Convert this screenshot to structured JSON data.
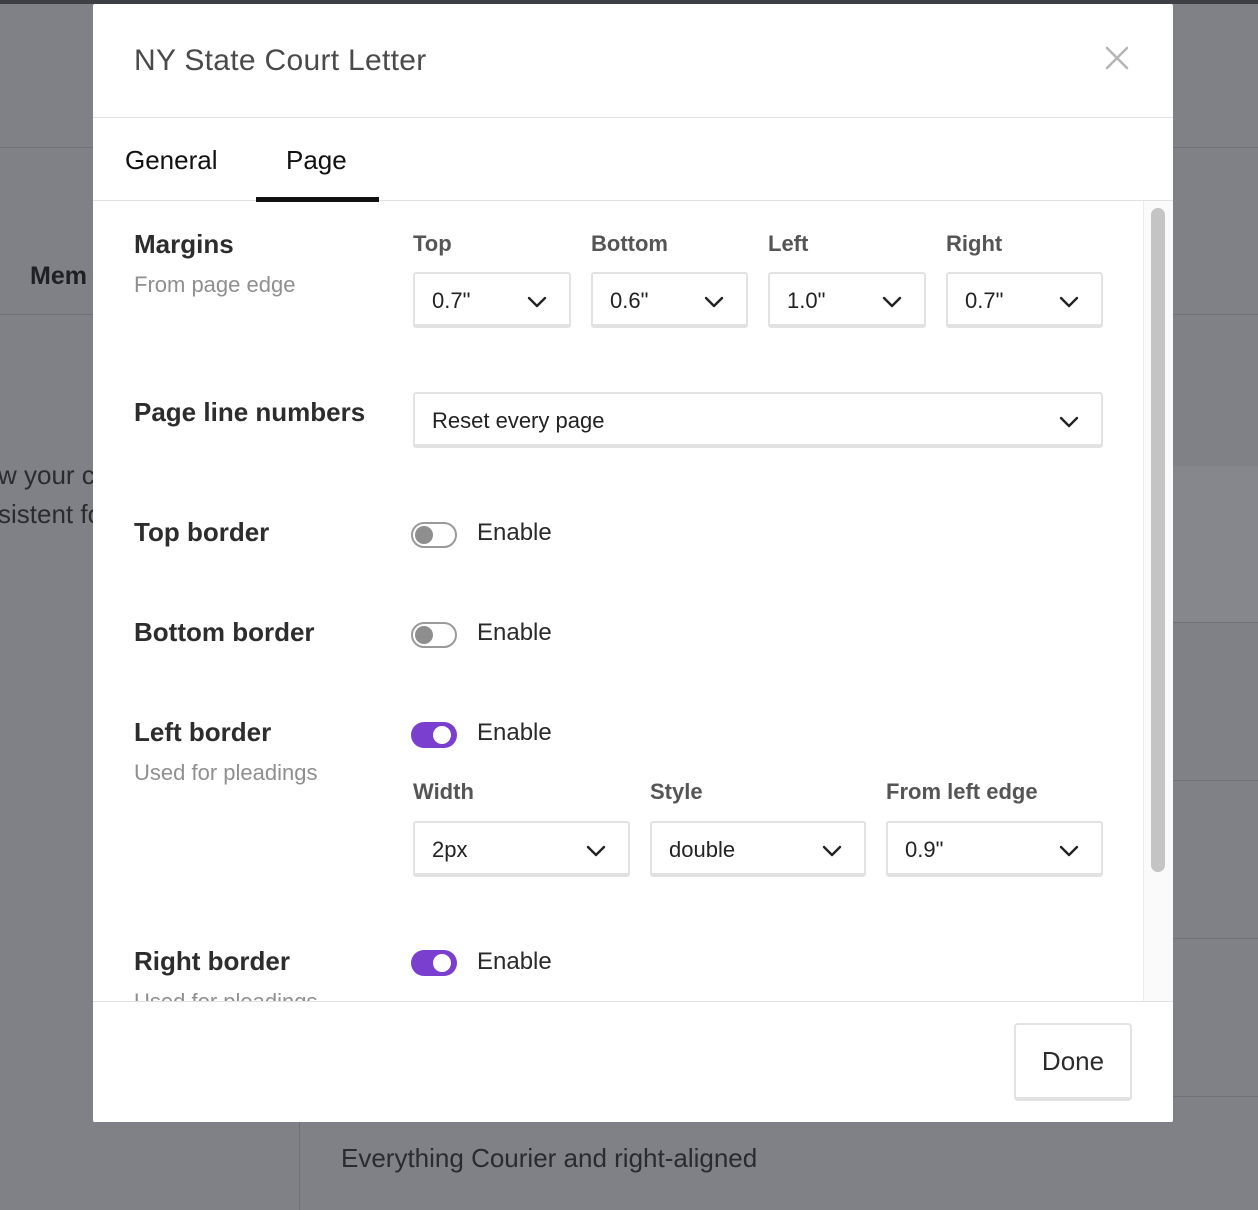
{
  "background": {
    "nav_fragment": "Mem",
    "text_line1": "w your c",
    "text_line2": "sistent fo",
    "bottom_text": "Everything Courier and right-aligned"
  },
  "modal": {
    "title": "NY State Court Letter",
    "close_icon": "close-icon",
    "tabs": [
      {
        "label": "General",
        "active": false
      },
      {
        "label": "Page",
        "active": true
      }
    ],
    "margins": {
      "label": "Margins",
      "sublabel": "From page edge",
      "top": {
        "label": "Top",
        "value": "0.7\""
      },
      "bottom": {
        "label": "Bottom",
        "value": "0.6\""
      },
      "left": {
        "label": "Left",
        "value": "1.0\""
      },
      "right": {
        "label": "Right",
        "value": "0.7\""
      }
    },
    "line_numbers": {
      "label": "Page line numbers",
      "value": "Reset every page"
    },
    "top_border": {
      "label": "Top border",
      "toggle_label": "Enable",
      "enabled": false
    },
    "bottom_border": {
      "label": "Bottom border",
      "toggle_label": "Enable",
      "enabled": false
    },
    "left_border": {
      "label": "Left border",
      "sublabel": "Used for pleadings",
      "toggle_label": "Enable",
      "enabled": true,
      "width": {
        "label": "Width",
        "value": "2px"
      },
      "style": {
        "label": "Style",
        "value": "double"
      },
      "from_edge": {
        "label": "From left edge",
        "value": "0.9\""
      }
    },
    "right_border": {
      "label": "Right border",
      "sublabel": "Used for pleadings",
      "toggle_label": "Enable",
      "enabled": true
    },
    "done_label": "Done",
    "accent_color": "#7b3fd0"
  }
}
